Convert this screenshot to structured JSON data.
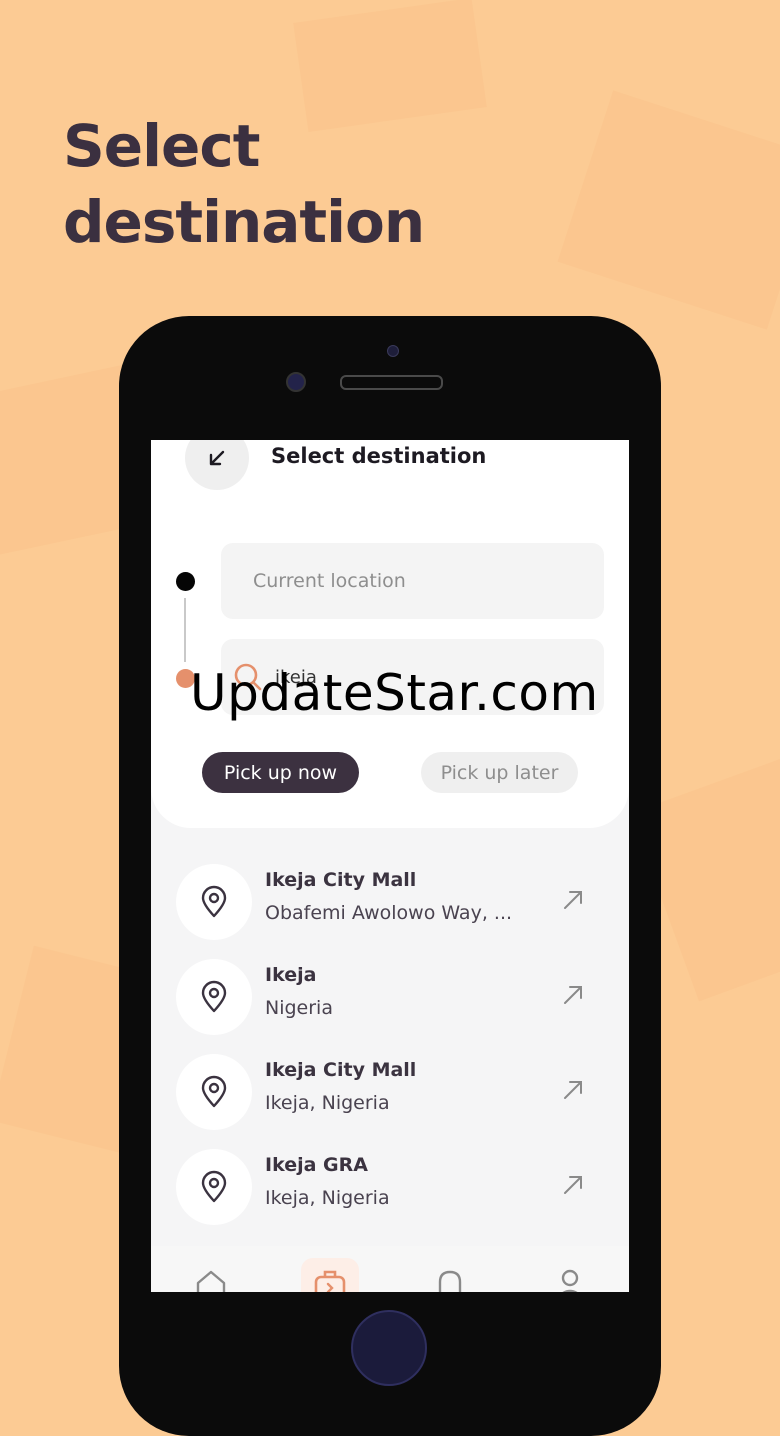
{
  "background_color": "#fccb94",
  "headline": {
    "line1": "Select",
    "line2": "destination"
  },
  "screen": {
    "header": {
      "back_icon": "back-arrow-icon",
      "title": "Select destination"
    },
    "route": {
      "current_location_placeholder": "Current location",
      "search_value": "ikeja",
      "start_dot_color": "#050505",
      "end_dot_color": "#e5906c"
    },
    "pickup": {
      "now_label": "Pick up now",
      "later_label": "Pick up later",
      "selected": "Pick up now"
    },
    "results": [
      {
        "title": "Ikeja City Mall",
        "subtitle": "Obafemi Awolowo Way, ..."
      },
      {
        "title": "Ikeja",
        "subtitle": "Nigeria"
      },
      {
        "title": "Ikeja City Mall",
        "subtitle": "Ikeja, Nigeria"
      },
      {
        "title": "Ikeja GRA",
        "subtitle": "Ikeja, Nigeria"
      }
    ],
    "bottom_nav": [
      {
        "icon": "home-icon",
        "active": false
      },
      {
        "icon": "briefcase-icon",
        "active": true
      },
      {
        "icon": "bell-icon",
        "active": false
      },
      {
        "icon": "profile-icon",
        "active": false
      }
    ]
  },
  "watermark": "UpdateStar.com",
  "colors": {
    "accent": "#e5906c",
    "dark": "#3c3140"
  }
}
